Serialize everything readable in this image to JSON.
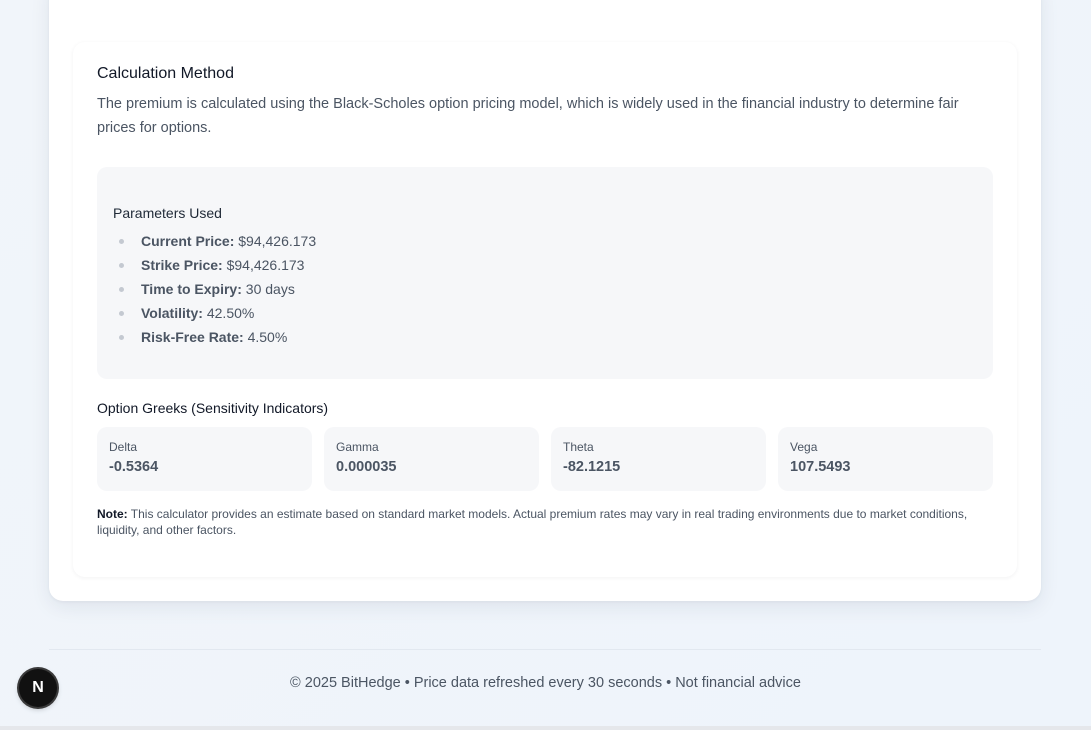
{
  "calculation": {
    "title": "Calculation Method",
    "description": "The premium is calculated using the Black-Scholes option pricing model, which is widely used in the financial industry to determine fair prices for options."
  },
  "parameters": {
    "title": "Parameters Used",
    "items": [
      {
        "label": "Current Price:",
        "value": "$94,426.173"
      },
      {
        "label": "Strike Price:",
        "value": "$94,426.173"
      },
      {
        "label": "Time to Expiry:",
        "value": "30 days"
      },
      {
        "label": "Volatility:",
        "value": "42.50%"
      },
      {
        "label": "Risk-Free Rate:",
        "value": "4.50%"
      }
    ]
  },
  "greeks": {
    "title": "Option Greeks (Sensitivity Indicators)",
    "items": [
      {
        "label": "Delta",
        "value": "-0.5364"
      },
      {
        "label": "Gamma",
        "value": "0.000035"
      },
      {
        "label": "Theta",
        "value": "-82.1215"
      },
      {
        "label": "Vega",
        "value": "107.5493"
      }
    ]
  },
  "note": {
    "label": "Note:",
    "text": "This calculator provides an estimate based on standard market models. Actual premium rates may vary in real trading environments due to market conditions, liquidity, and other factors."
  },
  "footer": {
    "text": "© 2025 BitHedge • Price data refreshed every 30 seconds • Not financial advice"
  },
  "devtools_badge": {
    "letter": "N",
    "icon": "nextjs-icon"
  }
}
